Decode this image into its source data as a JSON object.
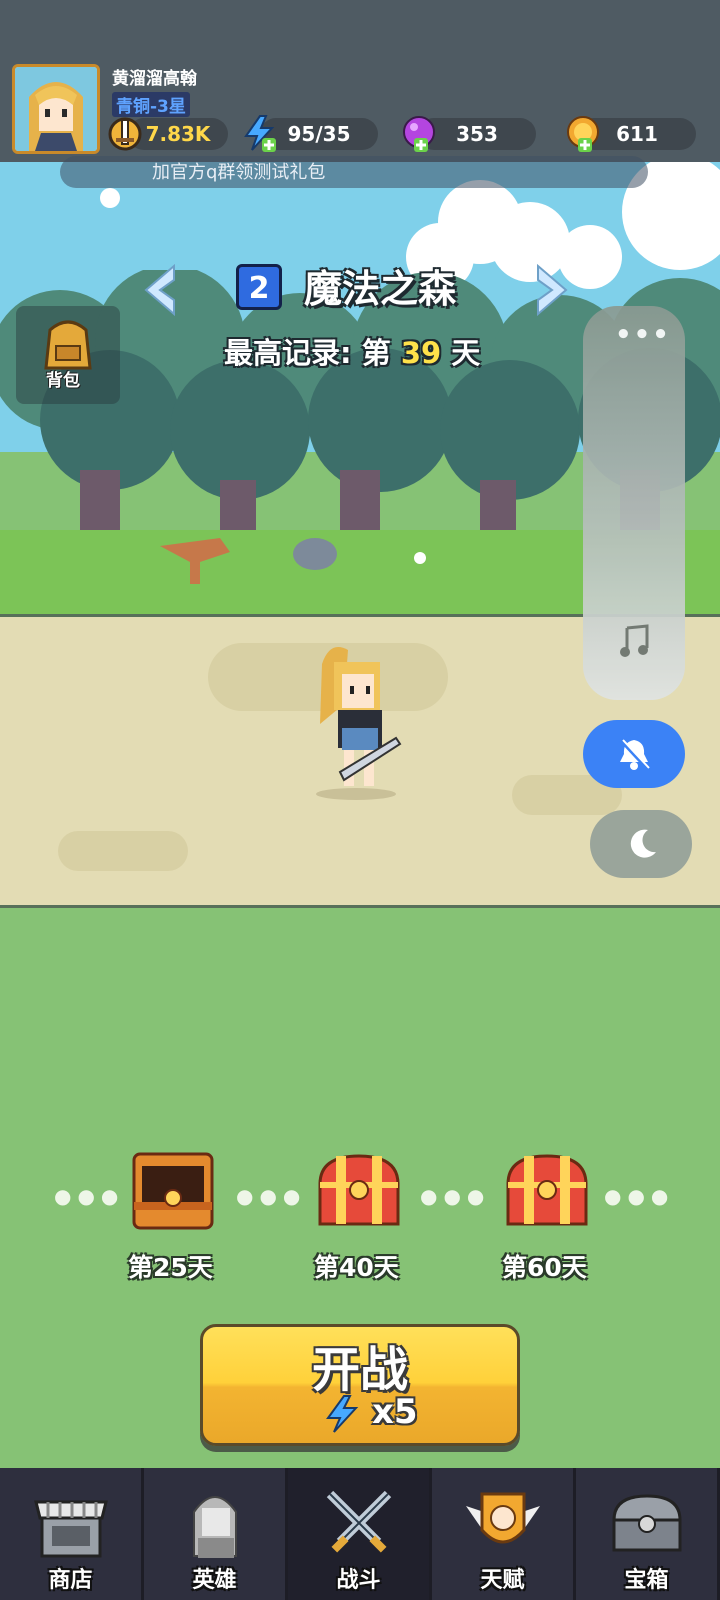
{
  "header": {
    "player_name": "黄溜溜高翰",
    "rank": "青铜-3星",
    "power": "7.83K",
    "energy": "95/35",
    "gems": "353",
    "coins": "611",
    "announcement": "加官方q群领测试礼包"
  },
  "stage": {
    "number": "2",
    "name": "魔法之森",
    "record_prefix": "最高记录: 第",
    "record_day": "39",
    "record_suffix": "天"
  },
  "backpack_label": "背包",
  "chests": [
    {
      "label": "第25天",
      "state": "opened"
    },
    {
      "label": "第40天",
      "state": "locked"
    },
    {
      "label": "第60天",
      "state": "locked"
    }
  ],
  "start_button": {
    "label": "开战",
    "cost": "x5"
  },
  "nav": [
    {
      "label": "商店",
      "icon": "shop-icon"
    },
    {
      "label": "英雄",
      "icon": "hero-icon"
    },
    {
      "label": "战斗",
      "icon": "swords-icon"
    },
    {
      "label": "天赋",
      "icon": "talent-icon"
    },
    {
      "label": "宝箱",
      "icon": "chest-icon"
    }
  ],
  "active_nav": "战斗",
  "side_panel": {
    "icons": [
      "more-icon",
      "music-icon",
      "bell-off-icon",
      "moon-icon"
    ]
  },
  "colors": {
    "accent": "#3b82f6",
    "button_yellow": "#ffd13a",
    "gold_text": "#ffe14a",
    "rank_blue": "#5fa3ff"
  }
}
